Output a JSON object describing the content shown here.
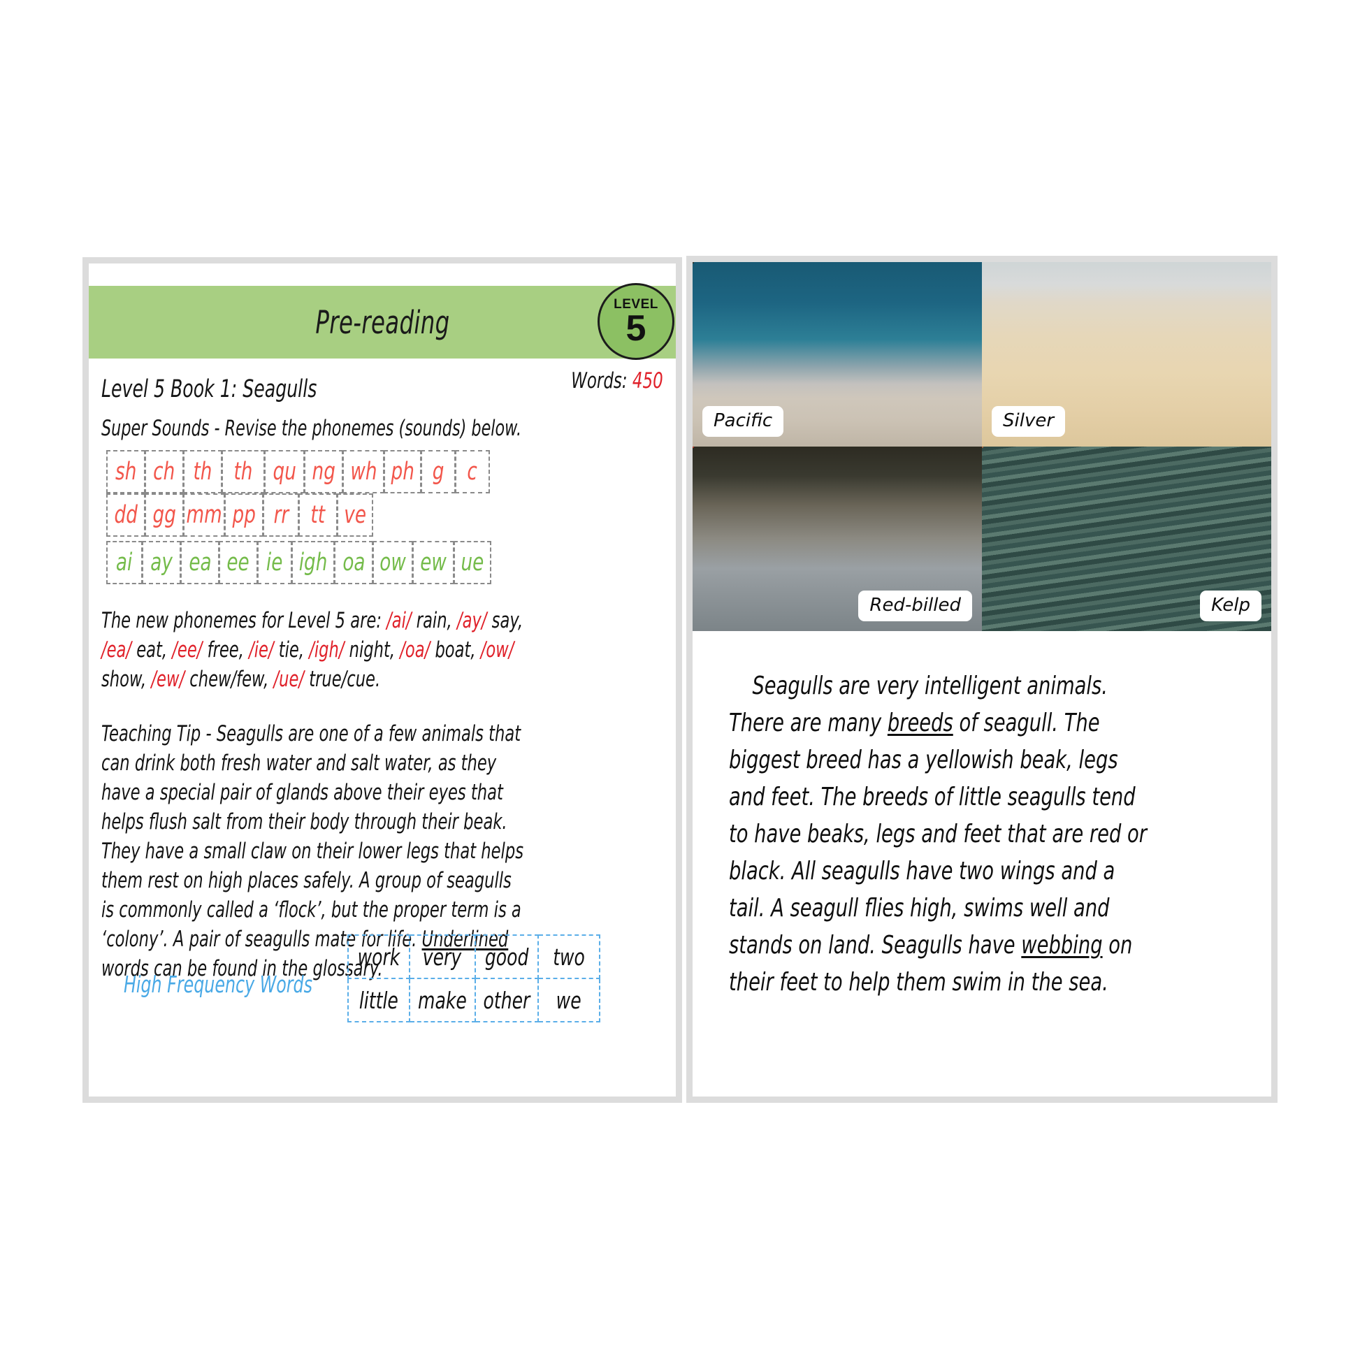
{
  "left_page": {
    "banner_title": "Pre-reading",
    "level_badge": {
      "word": "LEVEL",
      "number": "5"
    },
    "words": {
      "label": "Words: ",
      "count": "450"
    },
    "book_title": "Level 5 Book 1: Seagulls",
    "super_sounds_instruction": "Super Sounds - Revise the phonemes (sounds) below.",
    "phoneme_rows": {
      "consonants": [
        "sh",
        "ch",
        "th",
        "th",
        "qu",
        "ng",
        "wh",
        "ph",
        "g",
        "c"
      ],
      "doubles": [
        "dd",
        "gg",
        "mm",
        "pp",
        "rr",
        "tt",
        "ve"
      ],
      "vowels": [
        "ai",
        "ay",
        "ea",
        "ee",
        "ie",
        "igh",
        "oa",
        "ow",
        "ew",
        "ue"
      ]
    },
    "new_phonemes_paragraph": {
      "intro": "The new phonemes for Level 5 are: ",
      "items": [
        {
          "phoneme": "/ai/",
          "word": " rain, "
        },
        {
          "phoneme": "/ay/",
          "word": " say, "
        },
        {
          "phoneme": "/ea/",
          "word": " eat, "
        },
        {
          "phoneme": "/ee/",
          "word": " free, "
        },
        {
          "phoneme": "/ie/",
          "word": " tie, "
        },
        {
          "phoneme": "/igh/",
          "word": " night, "
        },
        {
          "phoneme": "/oa/",
          "word": " boat, "
        },
        {
          "phoneme": "/ow/",
          "word": " show, "
        },
        {
          "phoneme": "/ew/",
          "word": " chew/few, "
        },
        {
          "phoneme": "/ue/",
          "word": " true/cue."
        }
      ]
    },
    "teaching_tip": {
      "before": "Teaching Tip - Seagulls are one of a few animals that can drink both fresh water and salt water, as they have a special pair of glands above their eyes that helps flush salt from their body through their beak. They have a small claw on their lower legs that helps them rest on high places safely. A group of seagulls is commonly called a ‘flock’, but the proper term is a ‘colony’. A pair of seagulls mate for life. ",
      "underlined": "Underlined",
      "after": " words can be found in the glossary."
    },
    "high_frequency": {
      "label": "High Frequency Words",
      "rows": [
        [
          "work",
          "very",
          "good",
          "two"
        ],
        [
          "little",
          "make",
          "other",
          "we"
        ]
      ]
    }
  },
  "right_page": {
    "photos": [
      {
        "name": "pacific-gull-photo",
        "label": "Pacific",
        "label_position": "bottom-left"
      },
      {
        "name": "silver-gull-photo",
        "label": "Silver",
        "label_position": "bottom-left"
      },
      {
        "name": "red-billed-gull-photo",
        "label": "Red-billed",
        "label_position": "bottom-right"
      },
      {
        "name": "kelp-gull-photo",
        "label": "Kelp",
        "label_position": "bottom-right"
      }
    ],
    "body_text": {
      "part1": "Seagulls are very intelligent animals. There are many ",
      "underlined1": "breeds",
      "part2": " of seagull. The biggest breed has a yellowish beak, legs and feet. The breeds of little seagulls tend to have beaks, legs and feet that are red or black. All seagulls have two wings and a tail. A seagull flies high, swims well and stands on land. Seagulls have ",
      "underlined2": "webbing",
      "part3": " on their feet to help them swim in the sea."
    }
  },
  "colors": {
    "banner_green": "#a8cf82",
    "badge_green": "#8cc063",
    "phoneme_red": "#f2564b",
    "phoneme_green": "#74bb4a",
    "words_count_red": "#e0212a",
    "hfw_blue": "#49a9e6",
    "page_border": "#dcdcdc"
  }
}
